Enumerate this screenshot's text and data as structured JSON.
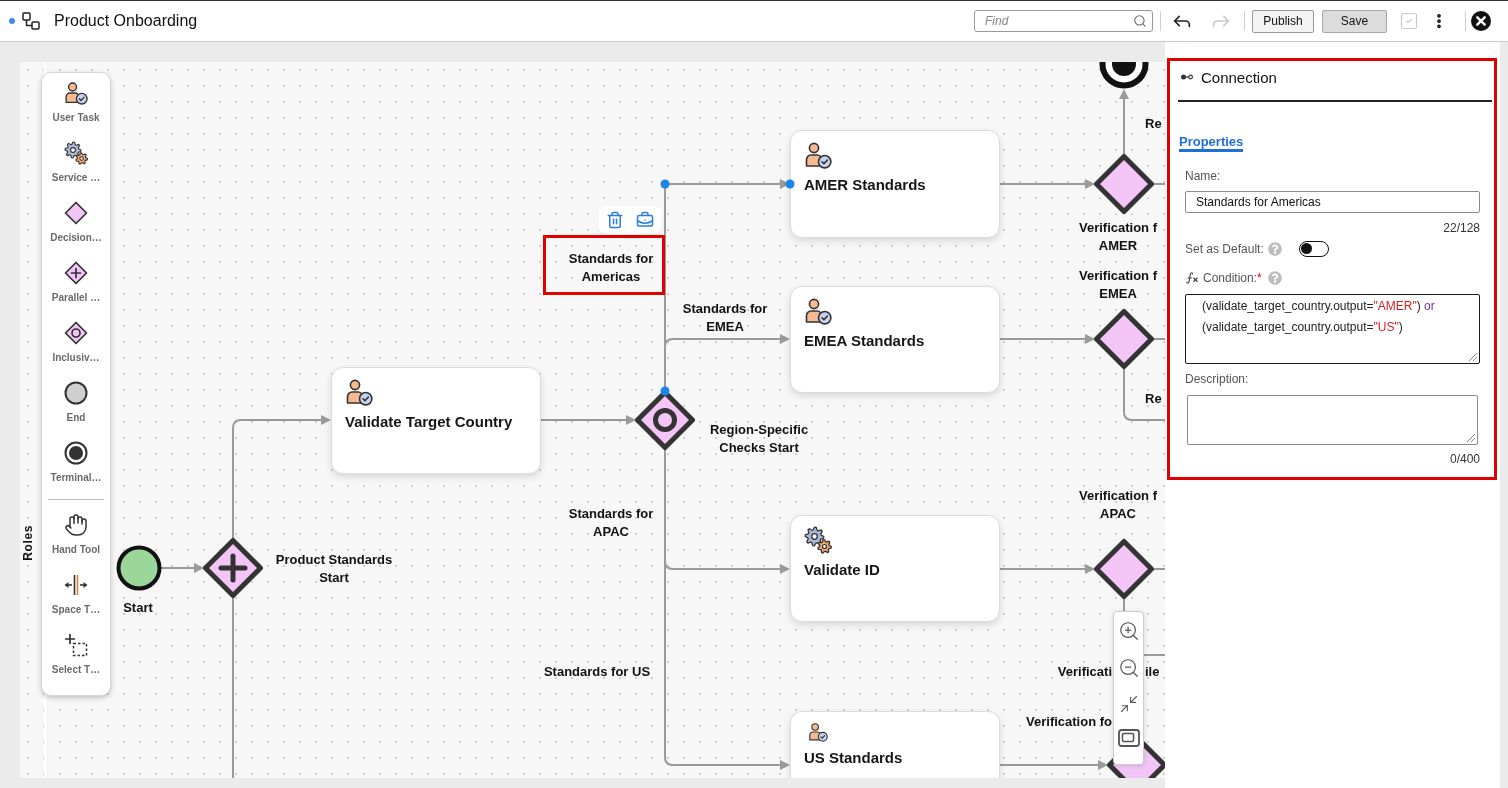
{
  "header": {
    "modified": true,
    "title": "Product Onboarding",
    "search": {
      "placeholder": "Find"
    },
    "history": [
      {
        "kind": "undo",
        "disabled": false
      },
      {
        "kind": "redo",
        "disabled": true
      }
    ],
    "buttons": [
      {
        "label": "Publish",
        "emphasized": false
      },
      {
        "label": "Save",
        "emphasized": true
      }
    ],
    "validate": {
      "disabled": true
    }
  },
  "palette": {
    "elements": [
      {
        "kind": "user_task",
        "label": "User Task"
      },
      {
        "kind": "service_task",
        "label": "Service …"
      },
      {
        "kind": "decision",
        "label": "Decision…"
      },
      {
        "kind": "parallel",
        "label": "Parallel …"
      },
      {
        "kind": "inclusive",
        "label": "Inclusiv…"
      },
      {
        "kind": "end",
        "label": "End"
      },
      {
        "kind": "terminal",
        "label": "Terminal…"
      }
    ],
    "tools": [
      {
        "kind": "hand",
        "label": "Hand Tool"
      },
      {
        "kind": "space",
        "label": "Space T…"
      },
      {
        "kind": "select",
        "label": "Select T…"
      }
    ]
  },
  "diagram": {
    "lane": {
      "label": "Roles"
    },
    "nodes": [
      {
        "kind": "start",
        "label": "Start"
      },
      {
        "kind": "parallel_gateway",
        "label": "Product Standards\nStart"
      },
      {
        "kind": "user_task",
        "label": "Validate Target Country"
      },
      {
        "kind": "inclusive_gateway",
        "label": "Region-Specific\nChecks Start"
      },
      {
        "kind": "user_task",
        "label": "AMER Standards"
      },
      {
        "kind": "user_task",
        "label": "EMEA Standards"
      },
      {
        "kind": "service_task",
        "label": "Validate ID"
      },
      {
        "kind": "user_task",
        "label": "US Standards"
      },
      {
        "kind": "exclusive_gateway",
        "label": "Verification f\nAMER"
      },
      {
        "kind": "exclusive_gateway",
        "label": "Verification f\nEMEA"
      },
      {
        "kind": "exclusive_gateway",
        "label": "Verification f\nAPAC"
      },
      {
        "kind": "exclusive_gateway",
        "label": "Verification fo"
      },
      {
        "kind": "terminal_end"
      }
    ],
    "connections": [
      {
        "selected": false
      },
      {
        "selected": false
      },
      {
        "selected": false
      },
      {
        "selected": false
      },
      {
        "label": "Standards for\nAmericas",
        "selected": true
      },
      {
        "label": "Standards for\nEMEA",
        "selected": false
      },
      {
        "label": "Standards for\nAPAC",
        "selected": false
      },
      {
        "label": "Standards for US",
        "selected": false
      },
      {
        "selected": false
      },
      {
        "selected": false
      },
      {
        "selected": false
      },
      {
        "selected": false
      },
      {
        "label": "Re",
        "selected": false
      },
      {
        "label": "Re",
        "selected": false
      },
      {
        "label": "Verificati",
        "label_tail": "ile",
        "selected": false
      },
      {
        "selected": false
      },
      {
        "selected": false
      },
      {
        "selected": false
      }
    ],
    "annotations": [
      {
        "kind": "frame"
      }
    ]
  },
  "panel": {
    "highlighted": true,
    "title": "Connection",
    "tabs": [
      {
        "label": "Properties",
        "selected": true
      }
    ],
    "name": {
      "label": "Name:",
      "value": "Standards for Americas",
      "counter": "22/128"
    },
    "default": {
      "label": "Set as Default:",
      "on": false
    },
    "condition": {
      "label": "Condition:",
      "required_mark": "*",
      "lines": [
        [
          {
            "kind": "text",
            "text": "(validate_target_country.output="
          },
          {
            "kind": "string",
            "text": "\"AMER\""
          },
          {
            "kind": "text",
            "text": ")"
          },
          {
            "kind": "keyword",
            "text": " or"
          }
        ],
        [
          {
            "kind": "text",
            "text": "(validate_target_country.output="
          },
          {
            "kind": "string",
            "text": "\"US\""
          },
          {
            "kind": "text",
            "text": ")"
          }
        ]
      ]
    },
    "description": {
      "label": "Description:",
      "counter": "0/400"
    }
  }
}
